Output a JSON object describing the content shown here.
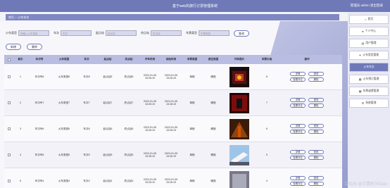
{
  "header": {
    "title": "基于web的旅行订票管理系统",
    "user": "管理员 admin  退出登录"
  },
  "breadcrumb": {
    "home": "首页",
    "current": "火车车次"
  },
  "search": {
    "fields": [
      {
        "label": "火车类型",
        "placeholder": "请输入火车类型"
      },
      {
        "label": "车次",
        "placeholder": "车次"
      },
      {
        "label": "起点站",
        "placeholder": "起点站"
      },
      {
        "label": "终点站",
        "placeholder": "终点站"
      },
      {
        "label": "车票类型",
        "placeholder": "车票类型"
      }
    ],
    "button": "查询"
  },
  "actions": {
    "add": "新增",
    "delete": "删除"
  },
  "table": {
    "headers": [
      "",
      "索引",
      "车次号",
      "火车类型",
      "车次",
      "起点站",
      "终点站",
      "开车时间",
      "到站时间",
      "车票类型",
      "座位类型",
      "列车图片",
      "车票价格",
      "操作"
    ],
    "rows": [
      {
        "idx": "1",
        "num": "车次号8",
        "type": "火车类型8",
        "trip": "车次8",
        "from": "起点站8",
        "to": "终点站8",
        "dep1": "2023-01-05",
        "dep2": "15:26:19",
        "arr1": "2023-01-05",
        "arr2": "15:26:19",
        "ticket": "单程",
        "seat": "硬座",
        "price": "8"
      },
      {
        "idx": "2",
        "num": "车次号7",
        "type": "火车类型7",
        "trip": "车次7",
        "from": "起点站7",
        "to": "终点站7",
        "dep1": "2023-01-05",
        "dep2": "15:26:19",
        "arr1": "2023-01-05",
        "arr2": "15:26:19",
        "ticket": "单程",
        "seat": "硬座",
        "price": "7"
      },
      {
        "idx": "3",
        "num": "车次号6",
        "type": "火车类型6",
        "trip": "车次6",
        "from": "起点站6",
        "to": "终点站6",
        "dep1": "2023-01-05",
        "dep2": "15:26:19",
        "arr1": "2023-01-05",
        "arr2": "15:26:19",
        "ticket": "单程",
        "seat": "硬座",
        "price": "6"
      },
      {
        "idx": "4",
        "num": "车次号5",
        "type": "火车类型5",
        "trip": "车次5",
        "from": "起点站5",
        "to": "终点站5",
        "dep1": "2023-01-05",
        "dep2": "15:26:19",
        "arr1": "2023-01-05",
        "arr2": "15:26:19",
        "ticket": "单程",
        "seat": "硬座",
        "price": "5"
      },
      {
        "idx": "5",
        "num": "车次号4",
        "type": "火车类型4",
        "trip": "车次4",
        "from": "起点站4",
        "to": "终点站4",
        "dep1": "2023-01-05",
        "dep2": "15:26:19",
        "arr1": "2023-01-05",
        "arr2": "15:26:19",
        "ticket": "单程",
        "seat": "硬座",
        "price": "4"
      }
    ],
    "op": {
      "detail": "详情",
      "edit": "修改",
      "comment": "查看评论",
      "delete": "删除"
    }
  },
  "sidebar": {
    "items": [
      {
        "label": "首页",
        "icon": "home-icon"
      },
      {
        "label": "个人中心",
        "icon": "user-icon"
      },
      {
        "label": "用户管理",
        "icon": "users-icon"
      },
      {
        "label": "火车类型管理",
        "icon": "train-icon"
      },
      {
        "label": "火车车次",
        "icon": "ticket-icon"
      },
      {
        "label": "火车预订管理",
        "icon": "order-icon"
      },
      {
        "label": "车票退票管理",
        "icon": "refund-icon"
      },
      {
        "label": "系统管理",
        "icon": "gear-icon"
      }
    ]
  },
  "watermark": "CSDN @计算机YiDian",
  "colors": {
    "primary": "#6f79b8",
    "header": "#7f88c4",
    "thead": "#b9bde2"
  }
}
